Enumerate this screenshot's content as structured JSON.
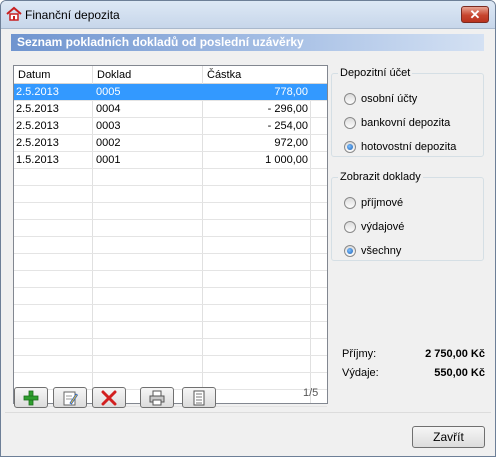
{
  "window": {
    "title": "Finanční depozita",
    "close_glyph": "✕"
  },
  "header": {
    "text": "Seznam pokladních dokladů od poslední uzávěrky"
  },
  "grid": {
    "columns": [
      "Datum",
      "Doklad",
      "Částka"
    ],
    "rows": [
      {
        "date": "2.5.2013",
        "doc": "0005",
        "amount": "778,00",
        "selected": true
      },
      {
        "date": "2.5.2013",
        "doc": "0004",
        "amount": "- 296,00"
      },
      {
        "date": "2.5.2013",
        "doc": "0003",
        "amount": "- 254,00"
      },
      {
        "date": "2.5.2013",
        "doc": "0002",
        "amount": "972,00"
      },
      {
        "date": "1.5.2013",
        "doc": "0001",
        "amount": "1 000,00"
      }
    ]
  },
  "account_group": {
    "title": "Depozitní účet",
    "options": [
      "osobní účty",
      "bankovní depozita",
      "hotovostní depozita"
    ],
    "selected_index": 2
  },
  "docs_group": {
    "title": "Zobrazit doklady",
    "options": [
      "příjmové",
      "výdajové",
      "všechny"
    ],
    "selected_index": 2
  },
  "summary": {
    "income_label": "Příjmy:",
    "income_value": "2 750,00 Kč",
    "expense_label": "Výdaje:",
    "expense_value": "550,00 Kč"
  },
  "toolbar": {
    "buttons": [
      "add-icon",
      "edit-icon",
      "delete-icon",
      "print-icon",
      "list-icon"
    ],
    "colors": {
      "add": "#2e9e2e",
      "delete": "#d21f1f",
      "edit": "#2b63c6"
    }
  },
  "pager": {
    "text": "1/5"
  },
  "footer": {
    "close_label": "Zavřít"
  }
}
